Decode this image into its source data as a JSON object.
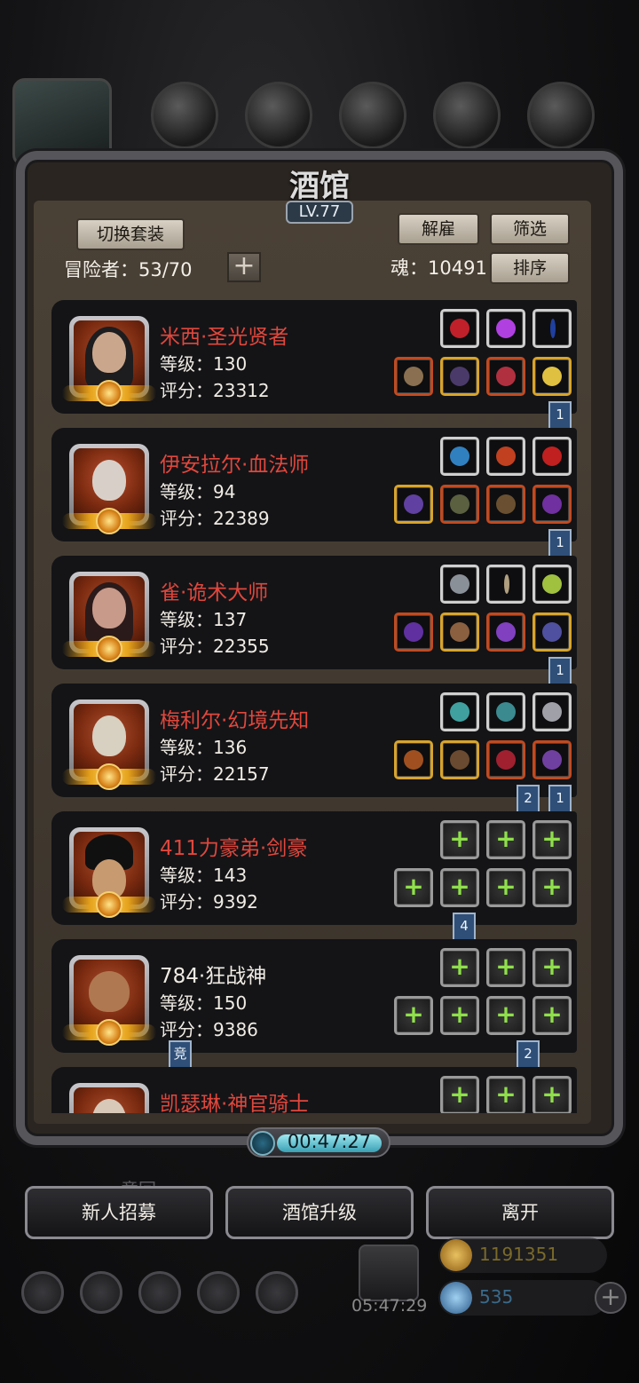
{
  "tavern": {
    "title": "酒馆",
    "level": "LV.77",
    "switch_outfit": "切换套装",
    "dismiss": "解雇",
    "filter": "筛选",
    "sort": "排序",
    "adventurers_label": "冒险者：53/70",
    "soul_label": "魂：10491",
    "plus": "+"
  },
  "heroes": [
    {
      "name": "米西·圣光贤者",
      "level": "等级：130",
      "score": "评分：23312",
      "name_color": "red"
    },
    {
      "name": "伊安拉尔·血法师",
      "level": "等级：94",
      "score": "评分：22389",
      "name_color": "red"
    },
    {
      "name": "雀·诡术大师",
      "level": "等级：137",
      "score": "评分：22355",
      "name_color": "red"
    },
    {
      "name": "梅利尔·幻境先知",
      "level": "等级：136",
      "score": "评分：22157",
      "name_color": "red"
    },
    {
      "name": "411力豪弟·剑豪",
      "level": "等级：143",
      "score": "评分：9392",
      "name_color": "red"
    },
    {
      "name": "784·狂战神",
      "level": "等级：150",
      "score": "评分：9386",
      "name_color": "white"
    },
    {
      "name": "凯瑟琳·神官骑士",
      "level": "",
      "score": "",
      "name_color": "red"
    }
  ],
  "ribbons": {
    "r1": "1",
    "r2": "1",
    "r3": "1",
    "r4a": "2",
    "r4b": "1",
    "r5": "4",
    "r6a": "竞",
    "r6b": "2"
  },
  "timer": "00:47:27",
  "buttons": {
    "recruit": "新人招募",
    "upgrade": "酒馆升级",
    "leave": "离开"
  },
  "hud": {
    "gift_time": "05:47:29",
    "gold": "1191351",
    "gems": "535",
    "ghost": "意回",
    "plus": "+"
  }
}
